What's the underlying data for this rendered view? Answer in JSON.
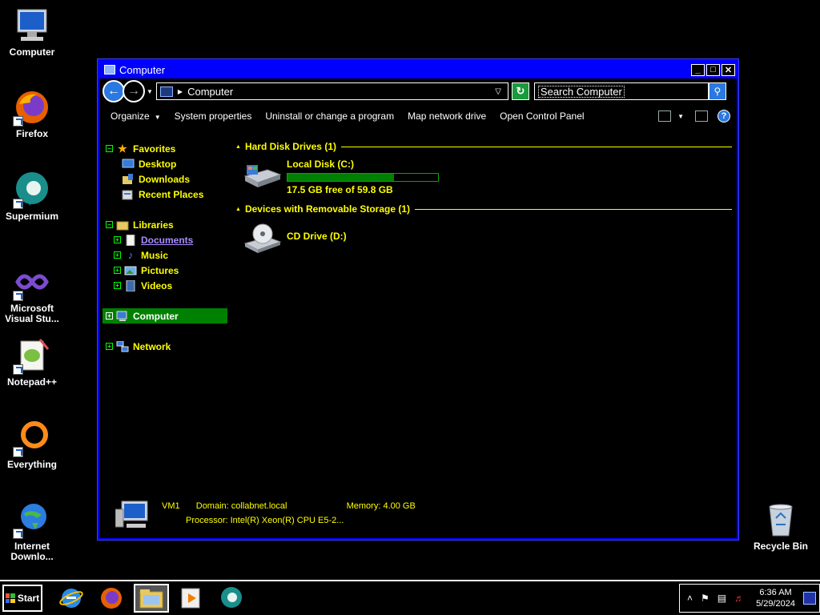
{
  "desktop": {
    "icons": [
      {
        "label": "Computer"
      },
      {
        "label": "Firefox"
      },
      {
        "label": "Supermium"
      },
      {
        "label": "Microsoft Visual Stu..."
      },
      {
        "label": "Notepad++"
      },
      {
        "label": "Everything"
      },
      {
        "label": "Internet Downlo..."
      },
      {
        "label": "Recycle Bin"
      }
    ]
  },
  "window": {
    "title": "Computer",
    "controls": {
      "minimize": "_",
      "maximize": "□",
      "close": "✕"
    },
    "address": {
      "path": "Computer",
      "separator": "▸"
    },
    "search_text": "Search Computer",
    "toolbar": {
      "organize": "Organize",
      "system_properties": "System properties",
      "uninstall": "Uninstall or change a program",
      "map_drive": "Map network drive",
      "control_panel": "Open Control Panel",
      "help": "?"
    },
    "nav": {
      "favorites": "Favorites",
      "desktop": "Desktop",
      "downloads": "Downloads",
      "recent": "Recent Places",
      "libraries": "Libraries",
      "documents": "Documents",
      "music": "Music",
      "pictures": "Pictures",
      "videos": "Videos",
      "computer": "Computer",
      "network": "Network"
    },
    "groups": {
      "hdd": "Hard Disk Drives (1)",
      "removable": "Devices with Removable Storage (1)"
    },
    "drives": {
      "c": {
        "name": "Local Disk (C:)",
        "free": "17.5 GB free of 59.8 GB",
        "used_fraction": 0.71
      },
      "d": {
        "name": "CD Drive (D:)"
      }
    },
    "details": {
      "name": "VM1",
      "domain": "Domain: collabnet.local",
      "memory": "Memory: 4.00 GB",
      "processor": "Processor: Intel(R) Xeon(R) CPU E5-2..."
    }
  },
  "taskbar": {
    "start": "Start",
    "time": "6:36 AM",
    "date": "5/29/2024"
  },
  "colors": {
    "title_bar": "#0000ff",
    "accent_text": "#ffff00",
    "selection": "#008000"
  }
}
